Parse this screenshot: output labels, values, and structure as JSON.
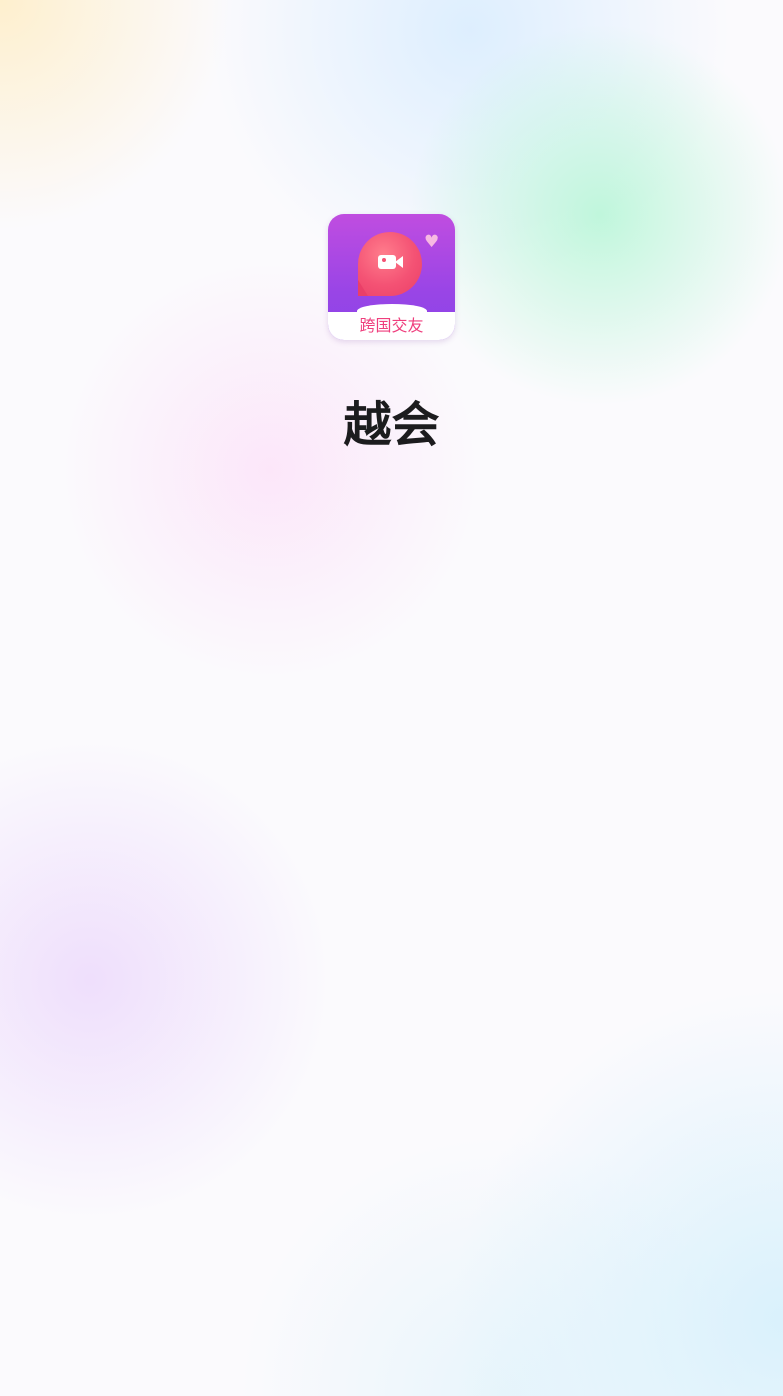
{
  "splash": {
    "app_name": "越会",
    "icon": {
      "name": "video-chat-bubble-icon",
      "banner_text": "跨国交友",
      "colors": {
        "gradient_top": "#c04de0",
        "gradient_bottom": "#8a44e8",
        "bubble": "#f45274",
        "banner_text": "#ef3e7d",
        "heart": "#f7b9e2"
      }
    }
  }
}
